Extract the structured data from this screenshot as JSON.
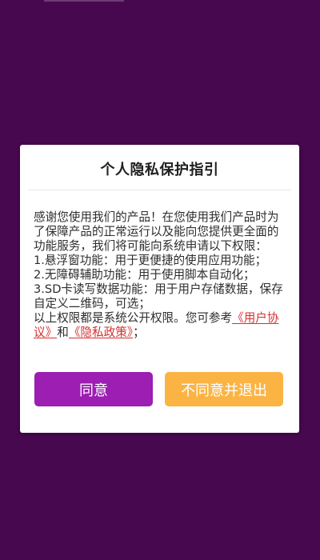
{
  "dialog": {
    "title": "个人隐私保护指引",
    "body": {
      "intro": "感谢您使用我们的产品！在您使用我们产品时为了保障产品的正常运行以及能向您提供更全面的功能服务，我们将可能向系统申请以下权限：",
      "items": [
        "1.悬浮窗功能：用于更便捷的使用应用功能；",
        "2.无障碍辅助功能：用于使用脚本自动化；",
        "3.SD卡读写数据功能：用于用户存储数据，保存自定义二维码，可选；"
      ],
      "closing_prefix": "以上权限都是系统公开权限。您可参考",
      "user_agreement_link": "《用户协议》",
      "and_text": "和",
      "privacy_policy_link": "《隐私政策》",
      "closing_suffix": "；"
    },
    "buttons": {
      "agree": "同意",
      "disagree": "不同意并退出"
    }
  },
  "colors": {
    "background": "#48084f",
    "agree_button": "#9c1eb2",
    "disagree_button": "#fbb444",
    "link": "#d33131"
  }
}
